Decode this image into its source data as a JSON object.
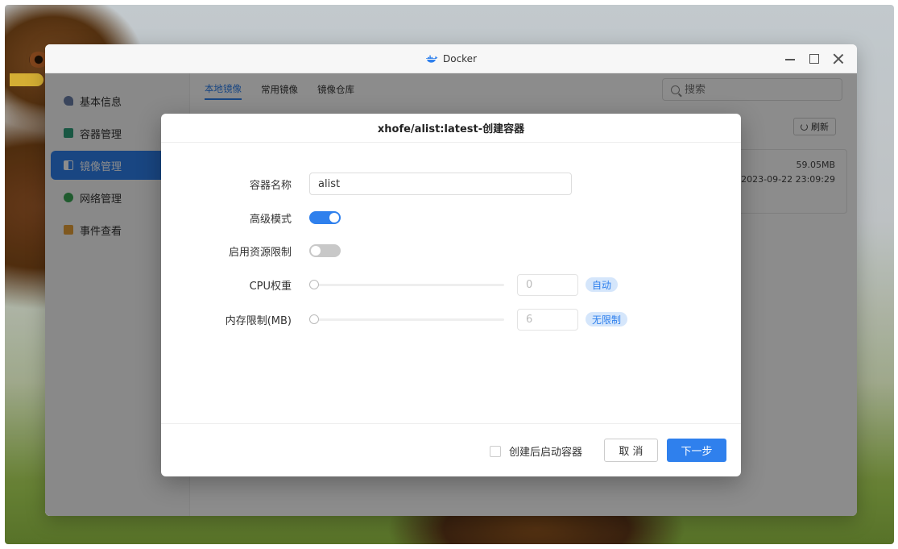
{
  "window": {
    "title": "Docker"
  },
  "sidebar": {
    "items": [
      {
        "label": "基本信息",
        "icon": "dashboard-icon",
        "color": "#6a7fa8"
      },
      {
        "label": "容器管理",
        "icon": "cube-icon",
        "color": "#2e9e7a"
      },
      {
        "label": "镜像管理",
        "icon": "image-icon",
        "color": "#ffffff",
        "active": true
      },
      {
        "label": "网络管理",
        "icon": "globe-icon",
        "color": "#3aa655"
      },
      {
        "label": "事件查看",
        "icon": "calendar-icon",
        "color": "#e8a13a"
      }
    ]
  },
  "tabs": [
    {
      "label": "本地镜像",
      "active": true
    },
    {
      "label": "常用镜像"
    },
    {
      "label": "镜像仓库"
    }
  ],
  "search": {
    "placeholder": "搜索"
  },
  "toolbar": {
    "refresh_label": "刷新"
  },
  "image_card": {
    "size": "59.05MB",
    "created": "2023-09-22 23:09:29"
  },
  "dialog": {
    "title": "xhofe/alist:latest-创建容器",
    "fields": {
      "name_label": "容器名称",
      "name_value": "alist",
      "advanced_label": "高级模式",
      "advanced_on": true,
      "resource_label": "启用资源限制",
      "resource_on": false,
      "cpu_label": "CPU权重",
      "cpu_value": "0",
      "cpu_badge": "自动",
      "mem_label": "内存限制(MB)",
      "mem_value": "6",
      "mem_badge": "无限制"
    },
    "footer": {
      "autostart_label": "创建后启动容器",
      "autostart_checked": false,
      "cancel_label": "取 消",
      "next_label": "下一步"
    }
  },
  "colors": {
    "accent": "#2f80ed",
    "badge_bg": "#d5e6fb"
  }
}
